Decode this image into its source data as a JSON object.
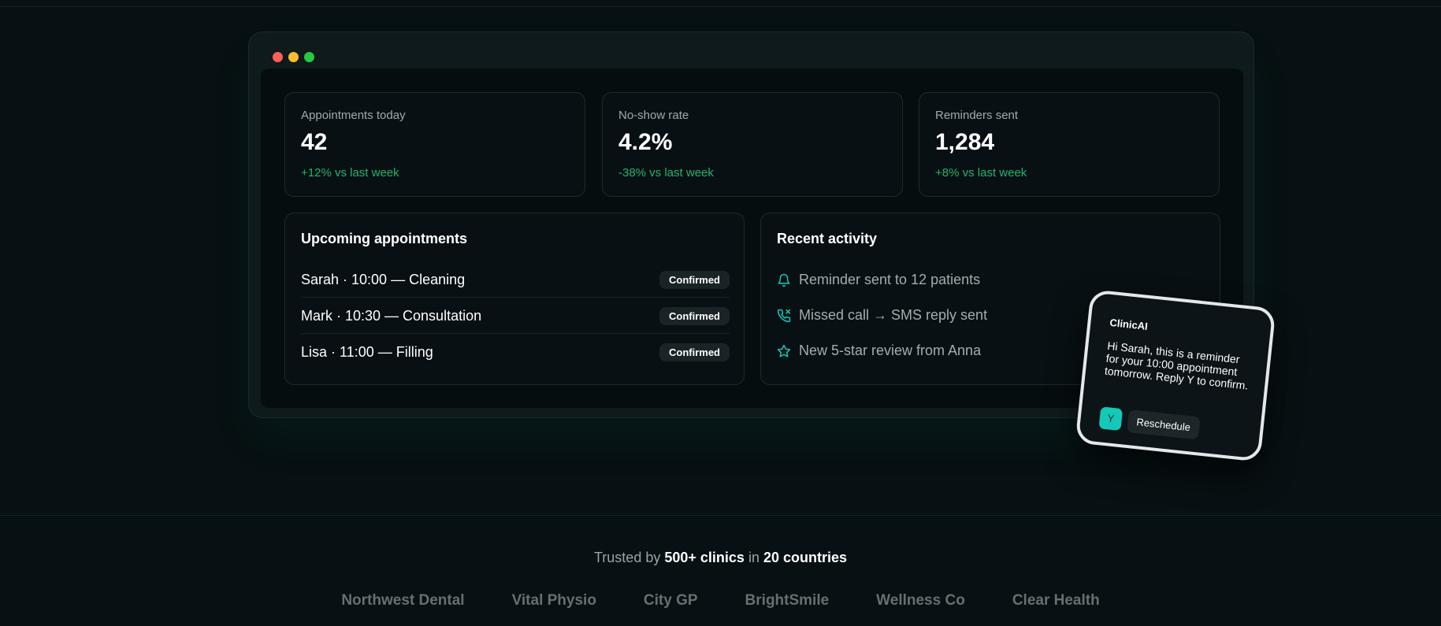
{
  "stats": [
    {
      "label": "Appointments today",
      "value": "42",
      "change": "+12% vs last week"
    },
    {
      "label": "No-show rate",
      "value": "4.2%",
      "change": "-38% vs last week"
    },
    {
      "label": "Reminders sent",
      "value": "1,284",
      "change": "+8% vs last week"
    }
  ],
  "upcoming": {
    "title": "Upcoming appointments",
    "items": [
      {
        "text": "Sarah · 10:00 — Cleaning",
        "status": "Confirmed"
      },
      {
        "text": "Mark · 10:30 — Consultation",
        "status": "Confirmed"
      },
      {
        "text": "Lisa · 11:00 — Filling",
        "status": "Confirmed"
      }
    ]
  },
  "activity": {
    "title": "Recent activity",
    "items": [
      {
        "icon": "bell-icon",
        "text": "Reminder sent to 12 patients"
      },
      {
        "icon": "missed-call-icon",
        "text": "Missed call → SMS reply sent"
      },
      {
        "icon": "star-icon",
        "text": "New 5-star review from Anna"
      }
    ]
  },
  "sms": {
    "app": "ClinicAI",
    "message": "Hi Sarah, this is a reminder for your 10:00 appointment tomorrow. Reply Y to confirm.",
    "reply_y": "Y",
    "reschedule": "Reschedule"
  },
  "trust": {
    "prefix": "Trusted by",
    "clinics": "500+ clinics",
    "middle": "in",
    "countries": "20 countries",
    "logos": [
      "Northwest Dental",
      "Vital Physio",
      "City GP",
      "BrightSmile",
      "Wellness Co",
      "Clear Health"
    ]
  },
  "colors": {
    "accent": "#14c9b8",
    "positive": "#22b36f",
    "background": "#071012"
  }
}
